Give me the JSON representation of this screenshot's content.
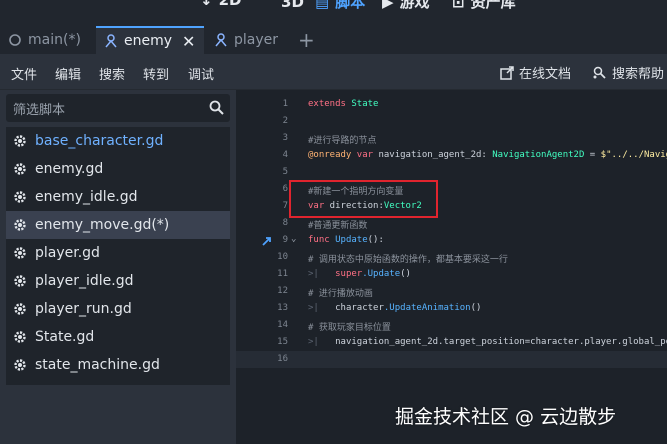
{
  "main_screens": [
    {
      "label": "2D"
    },
    {
      "label": "3D"
    },
    {
      "label": "脚本"
    },
    {
      "label": "游戏"
    },
    {
      "label": "资产库"
    }
  ],
  "tabs": [
    {
      "label": "main(*)"
    },
    {
      "label": "enemy"
    },
    {
      "label": "player"
    }
  ],
  "menu": {
    "items": [
      "文件",
      "编辑",
      "搜索",
      "转到",
      "调试"
    ],
    "online_docs": "在线文档",
    "search_help": "搜索帮助"
  },
  "filter": {
    "placeholder": "筛选脚本"
  },
  "files": [
    "base_character.gd",
    "enemy.gd",
    "enemy_idle.gd",
    "enemy_move.gd(*)",
    "player.gd",
    "player_idle.gd",
    "player_run.gd",
    "State.gd",
    "state_machine.gd"
  ],
  "code": {
    "line_numbers": [
      "1",
      "2",
      "3",
      "4",
      "5",
      "6",
      "7",
      "8",
      "9",
      "10",
      "11",
      "12",
      "13",
      "14",
      "15",
      "16"
    ],
    "l1_kw": "extends",
    "l1_type": " State",
    "l3_comment": "#进行导路的节点",
    "l4_annot": "@onready",
    "l4_kw": " var",
    "l4_name": " navigation_agent_2d: ",
    "l4_type": "NavigationAgent2D",
    "l4_eq": " = ",
    "l4_str": "$\"../../Navig",
    "l6_comment": "#新建一个指明方向变量",
    "l7_kw": "var",
    "l7_name": " direction:",
    "l7_type": "Vector2",
    "l8_comment": "#普通更新函数",
    "l9_kw": "func",
    "l9_fn": " Update",
    "l9_rest": "():",
    "l10_comment": "#\t调用状态中原始函数的操作，都基本要采这一行",
    "l11_kw": "super",
    "l11_fn": ".Update",
    "l11_rest": "()",
    "l12_comment": "#\t进行播放动画",
    "l13_obj": "character",
    "l13_fn": ".UpdateAnimation",
    "l13_rest": "()",
    "l14_comment": "#\t获取玩家目标位置",
    "l15_text": "navigation_agent_2d.target_position=character.player.global_pos"
  },
  "watermark": "掘金技术社区 @ 云边散步",
  "colors": {
    "accent": "#4fa3ff",
    "keyword": "#ff7085",
    "type": "#42ffc2",
    "function": "#57b3ff",
    "annotation": "#ffb373",
    "highlight_box": "#e0242e"
  }
}
